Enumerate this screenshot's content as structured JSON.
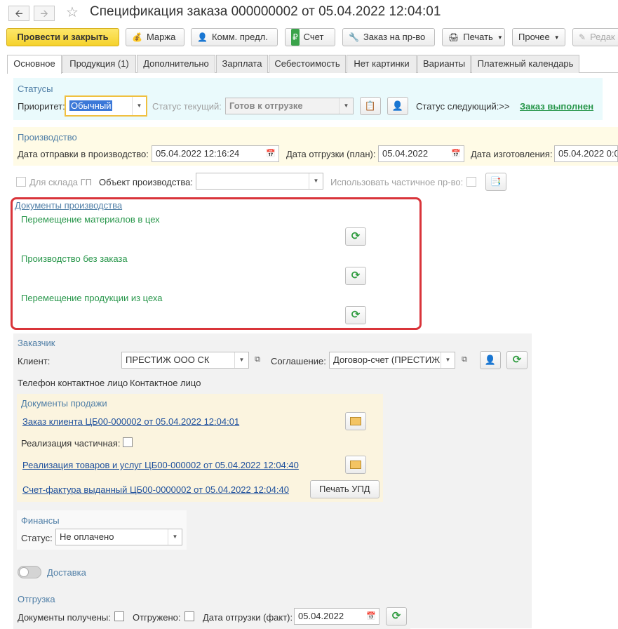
{
  "window": {
    "title": "Спецификация заказа 000000002 от 05.04.2022 12:04:01"
  },
  "toolbar": {
    "post_close": "Провести и закрыть",
    "markup": "Маржа",
    "commercial_offer": "Комм. предл.",
    "invoice": "Счет",
    "production_order": "Заказ на пр-во",
    "print": "Печать",
    "other": "Прочее",
    "edit": "Редак"
  },
  "tabs": [
    {
      "label": "Основное"
    },
    {
      "label": "Продукция (1)"
    },
    {
      "label": "Дополнительно"
    },
    {
      "label": "Зарплата"
    },
    {
      "label": "Себестоимость"
    },
    {
      "label": "Нет картинки"
    },
    {
      "label": "Варианты"
    },
    {
      "label": "Платежный календарь"
    }
  ],
  "statuses": {
    "group_title": "Статусы",
    "priority_label": "Приоритет:",
    "priority_value": "Обычный",
    "current_status_label": "Статус текущий:",
    "current_status_value": "Готов к отгрузке",
    "next_status_label": "Статус следующий:>>",
    "next_status_link": "Заказ выполнен"
  },
  "production": {
    "group_title": "Производство",
    "send_date_label": "Дата отправки в производство:",
    "send_date_value": "05.04.2022 12:16:24",
    "ship_plan_label": "Дата отгрузки (план):",
    "ship_plan_value": "05.04.2022",
    "make_date_label": "Дата изготовления:",
    "make_date_value": "05.04.2022  0:0"
  },
  "warehouse": {
    "for_warehouse_label": "Для склада ГП",
    "production_object_label": "Объект производства:",
    "production_object_value": "",
    "partial_production_label": "Использовать частичное пр-во:"
  },
  "production_docs": {
    "group_title": "Документы производства",
    "items": [
      {
        "label": "Перемещение материалов в цех"
      },
      {
        "label": "Производство без заказа"
      },
      {
        "label": "Перемещение продукции из цеха"
      }
    ]
  },
  "customer": {
    "group_title": "Заказчик",
    "client_label": "Клиент:",
    "client_value": "ПРЕСТИЖ ООО СК",
    "agreement_label": "Соглашение:",
    "agreement_value": "Договор-счет (ПРЕСТИЖ",
    "phone_label": "Телефон контактное лицо",
    "contact_label": "Контактное лицо"
  },
  "sales_docs": {
    "group_title": "Документы продажи",
    "order_link": "Заказ клиента ЦБ00-000002 от 05.04.2022 12:04:01",
    "partial_label": "Реализация частичная:",
    "realization_link": "Реализация товаров и услуг ЦБ00-000002 от 05.04.2022 12:04:40",
    "invoice_link": "Счет-фактура выданный ЦБ00-0000002 от 05.04.2022 12:04:40",
    "print_upd": "Печать УПД"
  },
  "finance": {
    "group_title": "Финансы",
    "status_label": "Статус:",
    "status_value": "Не оплачено"
  },
  "delivery": {
    "label": "Доставка"
  },
  "shipment": {
    "group_title": "Отгрузка",
    "docs_received_label": "Документы получены:",
    "shipped_label": "Отгружено:",
    "ship_fact_label": "Дата отгрузки (факт):",
    "ship_fact_value": "05.04.2022"
  },
  "colors": {
    "accent_yellow": "#f5d22c",
    "status_panel": "#eafafc",
    "production_panel": "#fffbe6",
    "customer_panel": "#f2f2f2",
    "sales_panel": "#fbf4df",
    "highlight_border": "#d9343a",
    "group_title": "#4f7ea6",
    "link": "#1d4f9c",
    "green_link": "#27964a"
  }
}
